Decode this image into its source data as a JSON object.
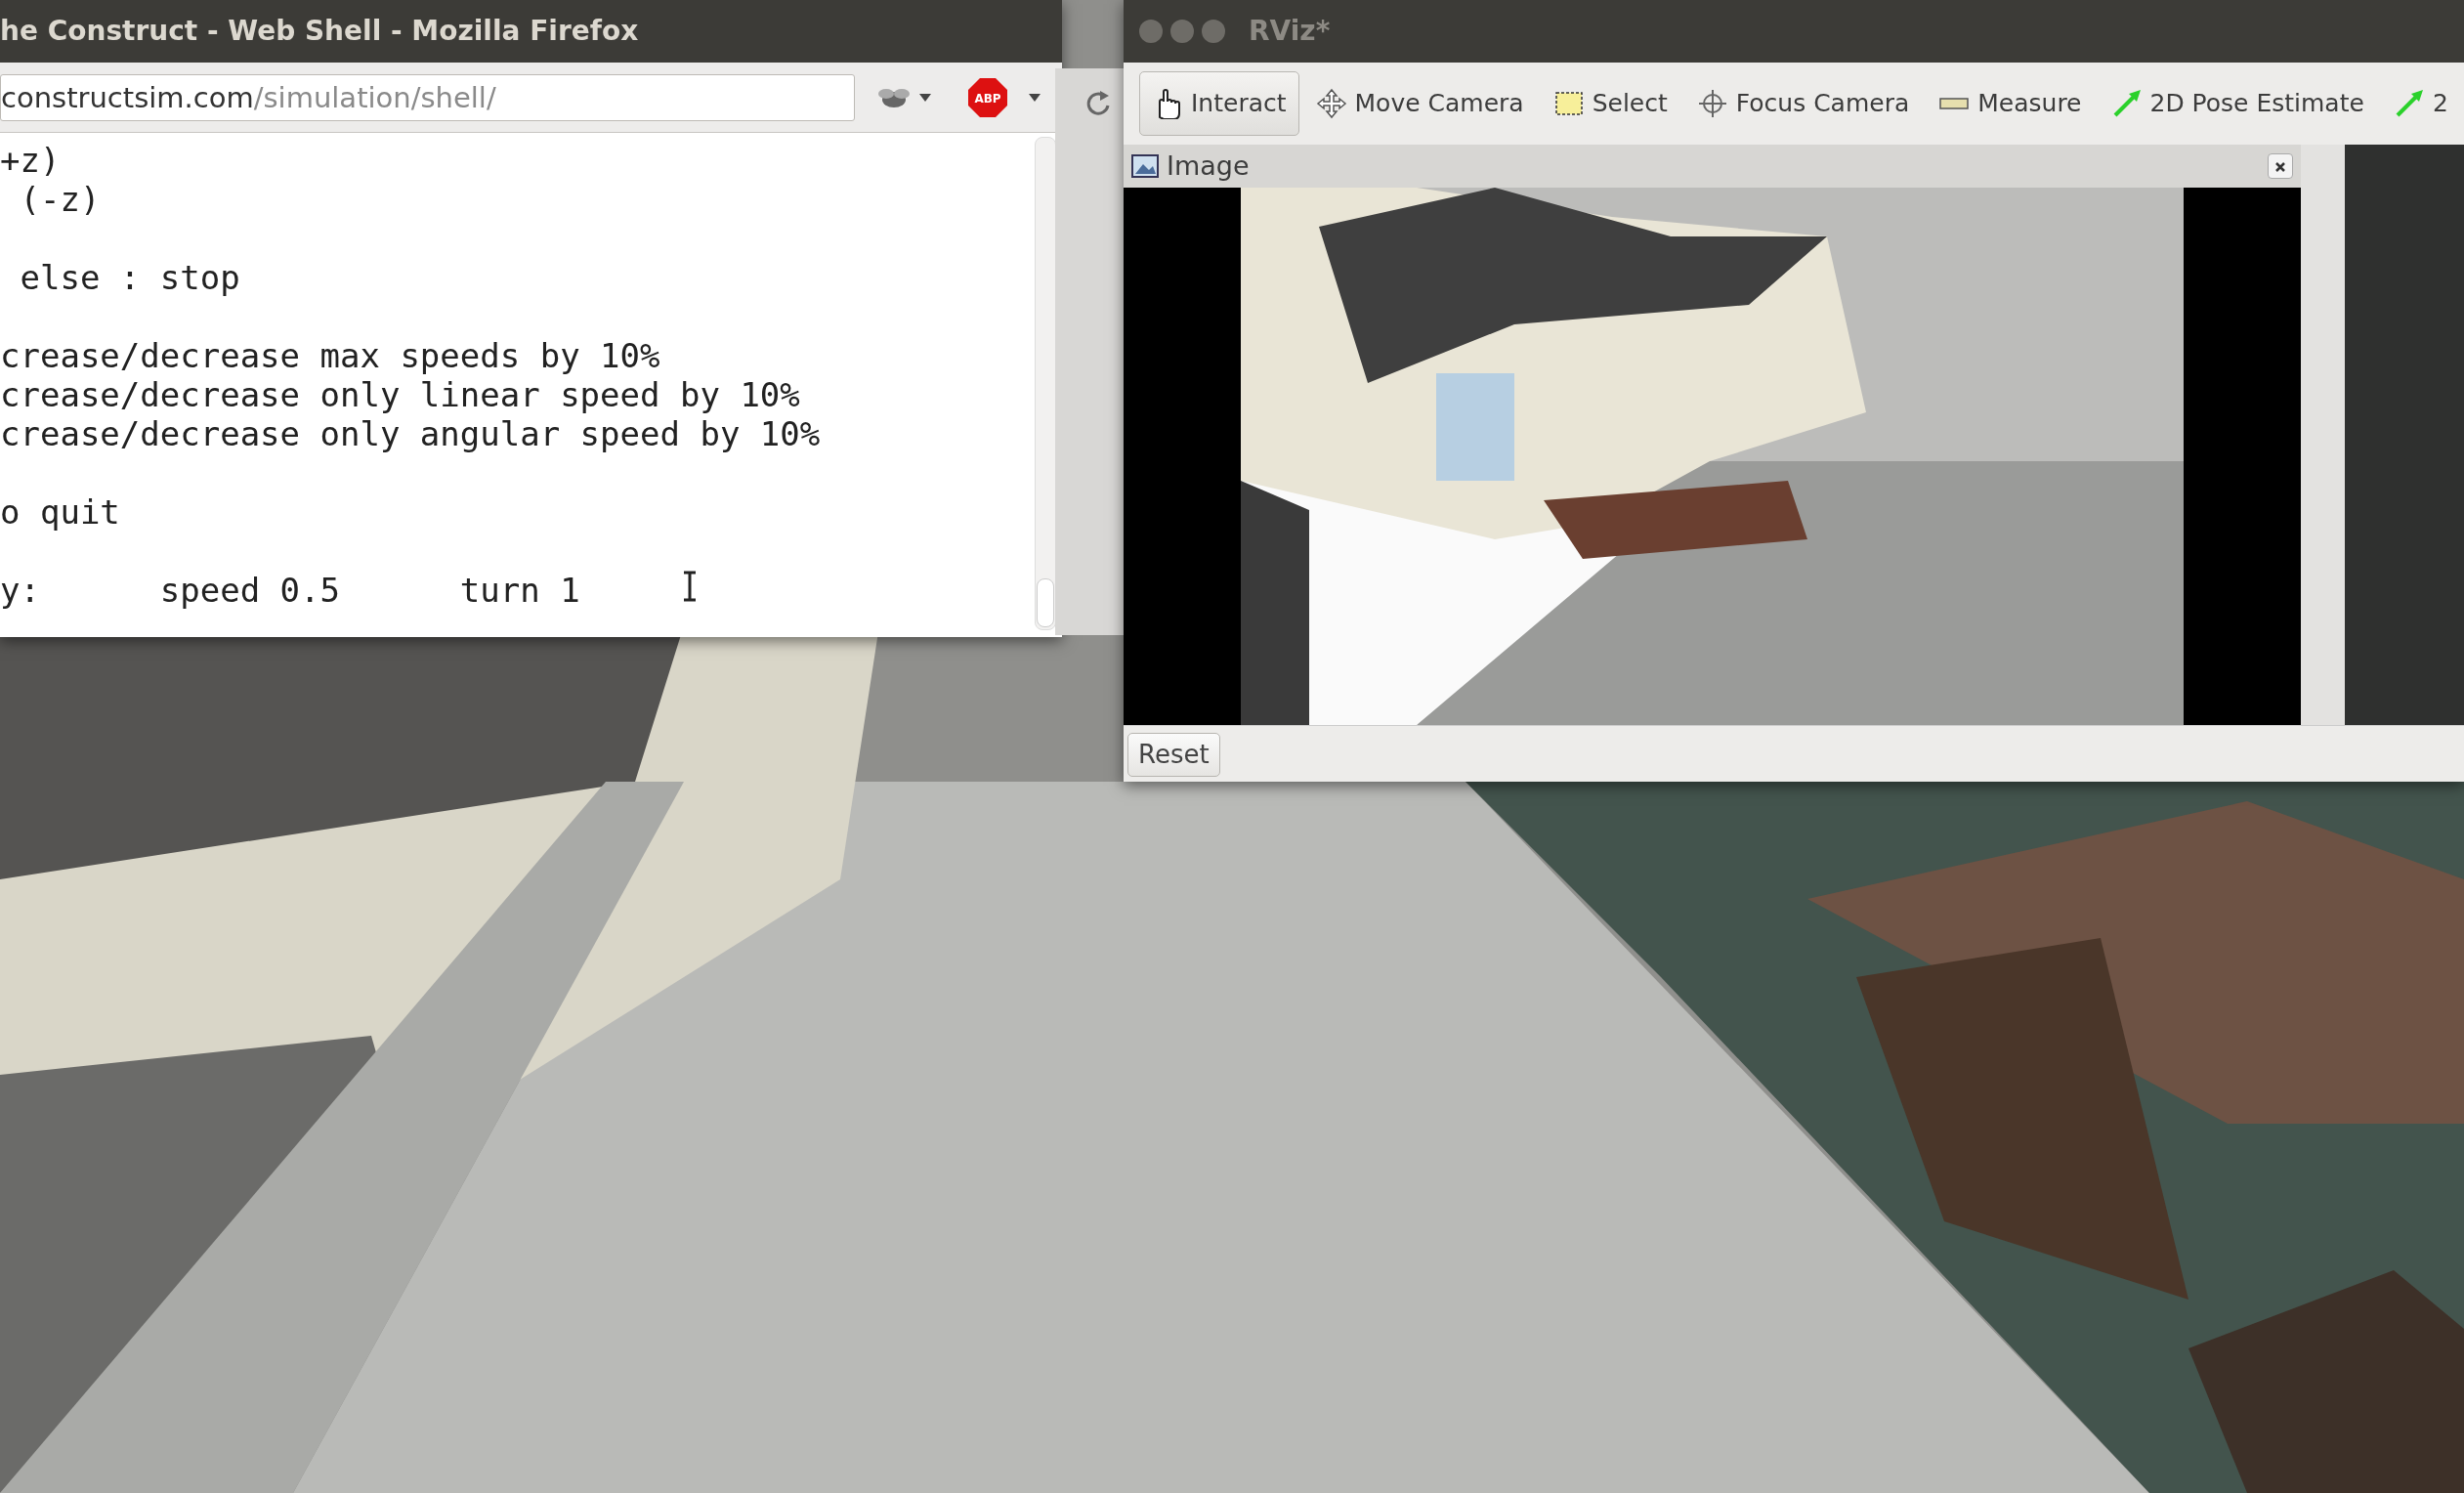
{
  "firefox": {
    "title": "he Construct - Web Shell - Mozilla Firefox",
    "url_host": "constructsim.com",
    "url_path": "/simulation/shell/",
    "abp_label": "ABP",
    "terminal_blocks": [
      [
        "+z)",
        " (-z)"
      ],
      [
        " else : stop"
      ],
      [
        "crease/decrease max speeds by 10%",
        "crease/decrease only linear speed by 10%",
        "crease/decrease only angular speed by 10%"
      ],
      [
        "o quit"
      ],
      [
        "y:      speed 0.5      turn 1"
      ]
    ]
  },
  "rviz": {
    "title": "RViz*",
    "tools": [
      {
        "kind": "hand",
        "label": "Interact",
        "selected": true
      },
      {
        "kind": "move",
        "label": "Move Camera",
        "selected": false
      },
      {
        "kind": "select",
        "label": "Select",
        "selected": false
      },
      {
        "kind": "focus",
        "label": "Focus Camera",
        "selected": false
      },
      {
        "kind": "measure",
        "label": "Measure",
        "selected": false
      },
      {
        "kind": "pose",
        "label": "2D Pose Estimate",
        "selected": false
      },
      {
        "kind": "pose",
        "label": "2",
        "selected": false
      }
    ],
    "panel": {
      "title": "Image"
    },
    "reset_button": "Reset"
  }
}
